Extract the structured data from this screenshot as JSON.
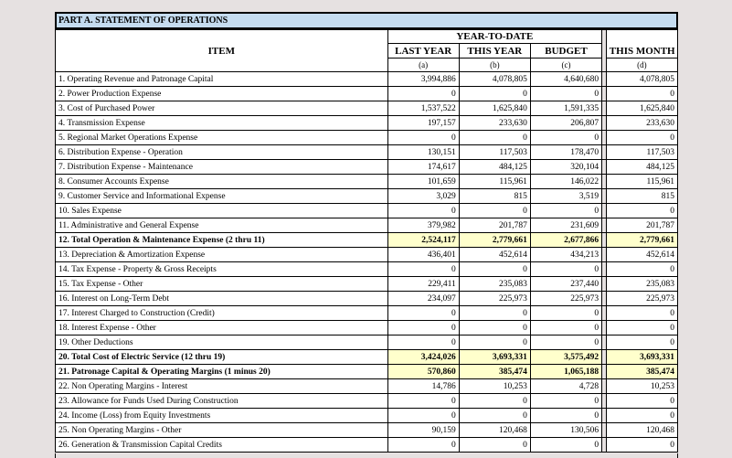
{
  "part_title": "PART A.   STATEMENT OF OPERATIONS",
  "headers": {
    "item": "ITEM",
    "ytd": "YEAR-TO-DATE",
    "last_year": "LAST YEAR",
    "this_year": "THIS YEAR",
    "budget": "BUDGET",
    "this_month": "THIS MONTH",
    "letter_a": "(a)",
    "letter_b": "(b)",
    "letter_c": "(c)",
    "letter_d": "(d)"
  },
  "rows": [
    {
      "label": "1.  Operating Revenue and Patronage Capital",
      "a": "3,994,886",
      "b": "4,078,805",
      "c": "4,640,680",
      "d": "4,078,805",
      "total": false
    },
    {
      "label": "2.  Power Production Expense",
      "a": "0",
      "b": "0",
      "c": "0",
      "d": "0",
      "total": false
    },
    {
      "label": "3.  Cost of Purchased Power",
      "a": "1,537,522",
      "b": "1,625,840",
      "c": "1,591,335",
      "d": "1,625,840",
      "total": false
    },
    {
      "label": "4.  Transmission Expense",
      "a": "197,157",
      "b": "233,630",
      "c": "206,807",
      "d": "233,630",
      "total": false
    },
    {
      "label": "5.  Regional Market Operations Expense",
      "a": "0",
      "b": "0",
      "c": "0",
      "d": "0",
      "total": false
    },
    {
      "label": "6.  Distribution Expense - Operation",
      "a": "130,151",
      "b": "117,503",
      "c": "178,470",
      "d": "117,503",
      "total": false
    },
    {
      "label": "7.  Distribution Expense - Maintenance",
      "a": "174,617",
      "b": "484,125",
      "c": "320,104",
      "d": "484,125",
      "total": false
    },
    {
      "label": "8.  Consumer Accounts Expense",
      "a": "101,659",
      "b": "115,961",
      "c": "146,022",
      "d": "115,961",
      "total": false
    },
    {
      "label": "9.  Customer Service and Informational Expense",
      "a": "3,029",
      "b": "815",
      "c": "3,519",
      "d": "815",
      "total": false
    },
    {
      "label": "10.  Sales Expense",
      "a": "0",
      "b": "0",
      "c": "0",
      "d": "0",
      "total": false
    },
    {
      "label": "11. Administrative and General Expense",
      "a": "379,982",
      "b": "201,787",
      "c": "231,609",
      "d": "201,787",
      "total": false
    },
    {
      "label": "12. Total Operation & Maintenance Expense (2 thru 11)",
      "a": "2,524,117",
      "b": "2,779,661",
      "c": "2,677,866",
      "d": "2,779,661",
      "total": true
    },
    {
      "label": "13. Depreciation & Amortization Expense",
      "a": "436,401",
      "b": "452,614",
      "c": "434,213",
      "d": "452,614",
      "total": false
    },
    {
      "label": "14. Tax Expense - Property & Gross Receipts",
      "a": "0",
      "b": "0",
      "c": "0",
      "d": "0",
      "total": false
    },
    {
      "label": "15. Tax Expense - Other",
      "a": "229,411",
      "b": "235,083",
      "c": "237,440",
      "d": "235,083",
      "total": false
    },
    {
      "label": "16. Interest on Long-Term Debt",
      "a": "234,097",
      "b": "225,973",
      "c": "225,973",
      "d": "225,973",
      "total": false
    },
    {
      "label": "17. Interest Charged to Construction (Credit)",
      "a": "0",
      "b": "0",
      "c": "0",
      "d": "0",
      "total": false
    },
    {
      "label": "18. Interest Expense - Other",
      "a": "0",
      "b": "0",
      "c": "0",
      "d": "0",
      "total": false
    },
    {
      "label": "19. Other Deductions",
      "a": "0",
      "b": "0",
      "c": "0",
      "d": "0",
      "total": false
    },
    {
      "label": "20. Total Cost of Electric Service (12 thru 19)",
      "a": "3,424,026",
      "b": "3,693,331",
      "c": "3,575,492",
      "d": "3,693,331",
      "total": true
    },
    {
      "label": "21. Patronage Capital & Operating Margins (1 minus 20)",
      "a": "570,860",
      "b": "385,474",
      "c": "1,065,188",
      "d": "385,474",
      "total": true
    },
    {
      "label": "22. Non Operating Margins - Interest",
      "a": "14,786",
      "b": "10,253",
      "c": "4,728",
      "d": "10,253",
      "total": false
    },
    {
      "label": "23. Allowance for Funds Used During Construction",
      "a": "0",
      "b": "0",
      "c": "0",
      "d": "0",
      "total": false
    },
    {
      "label": "24. Income (Loss) from Equity Investments",
      "a": "0",
      "b": "0",
      "c": "0",
      "d": "0",
      "total": false
    },
    {
      "label": "25. Non Operating Margins - Other",
      "a": "90,159",
      "b": "120,468",
      "c": "130,506",
      "d": "120,468",
      "total": false
    },
    {
      "label": "26. Generation & Transmission Capital Credits",
      "a": "0",
      "b": "0",
      "c": "0",
      "d": "0",
      "total": false
    }
  ]
}
